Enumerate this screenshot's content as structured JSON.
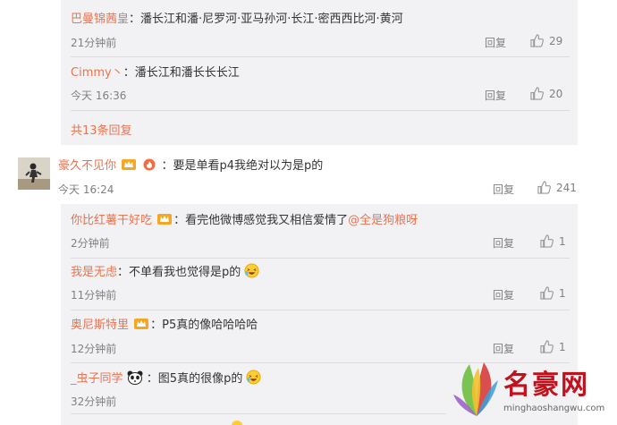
{
  "thread1": {
    "replies": [
      {
        "user": "巴曼锦茜皇",
        "text": "：潘长江和潘·尼罗河·亚马孙河·长江·密西西比河·黄河",
        "time": "21分钟前",
        "reply": "回复",
        "likes": "29"
      },
      {
        "user": "Cimmy丶",
        "text": "：潘长江和潘长长长江",
        "time": "今天 16:36",
        "reply": "回复",
        "likes": "20"
      }
    ],
    "more": "共13条回复"
  },
  "comment": {
    "user": "豪久不见你",
    "text": "：要是单看p4我绝对以为是p的",
    "time": "今天 16:24",
    "reply": "回复",
    "likes": "241"
  },
  "thread2": {
    "replies": [
      {
        "user": "你比红薯干好吃",
        "text": "：看完他微博感觉我又相信爱情了",
        "mention": "@全是狗粮呀",
        "time": "2分钟前",
        "reply": "回复",
        "likes": "1"
      },
      {
        "user": "我是无虑",
        "text": "：不单看我也觉得是p的",
        "time": "11分钟前",
        "reply": "回复",
        "likes": "1"
      },
      {
        "user": "奥尼斯特里",
        "text": "：P5真的像哈哈哈哈",
        "time": "12分钟前",
        "reply": "回复",
        "likes": "1"
      },
      {
        "user": "_虫子同学",
        "text": "：图5真的很像p的",
        "time": "32分钟前",
        "reply": "回复",
        "likes": "1"
      }
    ]
  },
  "watermark": {
    "title": "名豪网",
    "url": "minghaoshangwu.com"
  },
  "icons": {
    "like": "thumbs-up-icon",
    "badge": "vip-crown-icon",
    "emoji": "laughing-emoji-icon",
    "panda": "panda-emoji-icon"
  },
  "colors": {
    "username": "#eb7350",
    "muted": "#808080",
    "panel": "#f2f2f5"
  }
}
